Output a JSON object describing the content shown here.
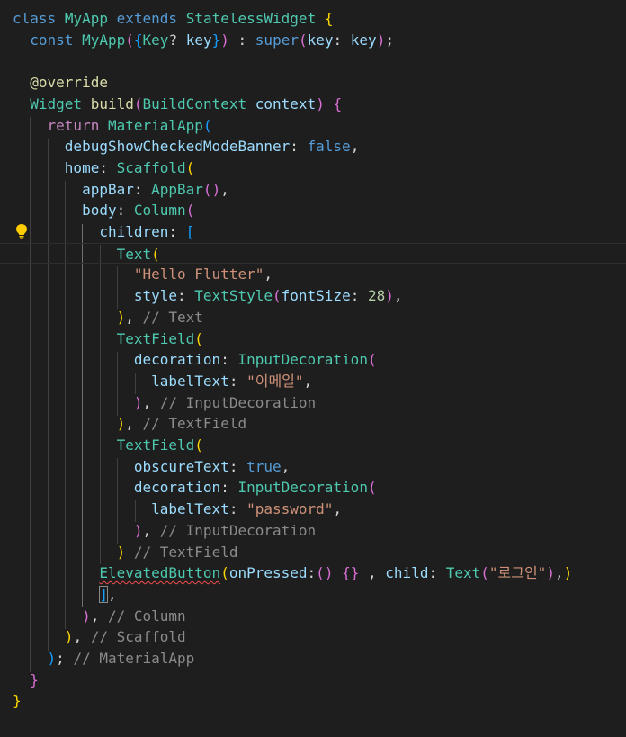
{
  "editor": {
    "lines": [
      "class MyApp extends StatelessWidget {",
      "  const MyApp({Key? key}) : super(key: key);",
      "",
      "  @override",
      "  Widget build(BuildContext context) {",
      "    return MaterialApp(",
      "      debugShowCheckedModeBanner: false,",
      "      home: Scaffold(",
      "        appBar: AppBar(),",
      "        body: Column(",
      "          children: [",
      "            Text(",
      "              \"Hello Flutter\",",
      "              style: TextStyle(fontSize: 28),",
      "            ), // Text",
      "            TextField(",
      "              decoration: InputDecoration(",
      "                labelText: \"이메일\",",
      "              ), // InputDecoration",
      "            ), // TextField",
      "            TextField(",
      "              obscureText: true,",
      "              decoration: InputDecoration(",
      "                labelText: \"password\",",
      "              ), // InputDecoration",
      "            ) // TextField",
      "          ElevatedButton(onPressed:() {} , child: Text(\"로그인\"),)",
      "          ],",
      "        ), // Column",
      "      ), // Scaffold",
      "    ); // MaterialApp",
      "  }",
      "}"
    ],
    "current_line": 11,
    "lightbulb_icon": "lightbulb-icon"
  }
}
